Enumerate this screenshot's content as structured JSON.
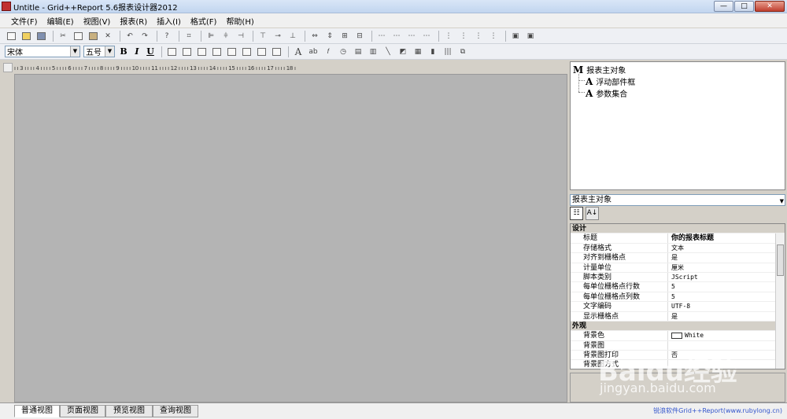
{
  "window": {
    "title": "Untitle - Grid++Report 5.6报表设计器2012",
    "btn_min": "—",
    "btn_max": "□",
    "btn_close": "✕"
  },
  "menu": [
    "文件(F)",
    "编辑(E)",
    "视图(V)",
    "报表(R)",
    "插入(I)",
    "格式(F)",
    "帮助(H)"
  ],
  "font": {
    "name": "宋体",
    "size": "五号",
    "bold": "B",
    "italic": "I",
    "underline": "U"
  },
  "ruler": "ı ı 3 ı ı ı ı 4 ı ı ı ı 5 ı ı ı ı 6 ı ı ı ı 7 ı ı ı ı 8 ı ı ı ı 9 ı ı ı ı 10 ı ı ı ı 11 ı ı ı ı 12 ı ı ı ı 13 ı ı ı ı 14 ı ı ı ı 15 ı ı ı ı 16 ı ı ı ı 17 ı ı ı ı 18 ı",
  "tree": {
    "root": "报表主对象",
    "children": [
      "浮动部件框",
      "参数集合"
    ]
  },
  "object_selector": "报表主对象",
  "props": [
    {
      "group": "设计"
    },
    {
      "k": "标题",
      "v": "你的报表标题",
      "bold": true
    },
    {
      "k": "存储格式",
      "v": "文本"
    },
    {
      "k": "对齐到栅格点",
      "v": "是"
    },
    {
      "k": "计量单位",
      "v": "厘米"
    },
    {
      "k": "脚本类别",
      "v": "JScript"
    },
    {
      "k": "每单位栅格点行数",
      "v": "5"
    },
    {
      "k": "每单位栅格点列数",
      "v": "5"
    },
    {
      "k": "文字编码",
      "v": "UTF-8"
    },
    {
      "k": "显示栅格点",
      "v": "是"
    },
    {
      "group": "外观"
    },
    {
      "k": "背景色",
      "v": "White",
      "swatch": true
    },
    {
      "k": "背景图",
      "v": ""
    },
    {
      "k": "背景图打印",
      "v": "否"
    },
    {
      "k": "背景图方式",
      "v": ""
    }
  ],
  "tabs": [
    "普通视图",
    "页面视图",
    "预览视图",
    "查询视图"
  ],
  "status": "锐浪软件Grid++Report(www.rubylong.cn)",
  "watermark": {
    "main": "Baidu经验",
    "sub": "jingyan.baidu.com"
  }
}
